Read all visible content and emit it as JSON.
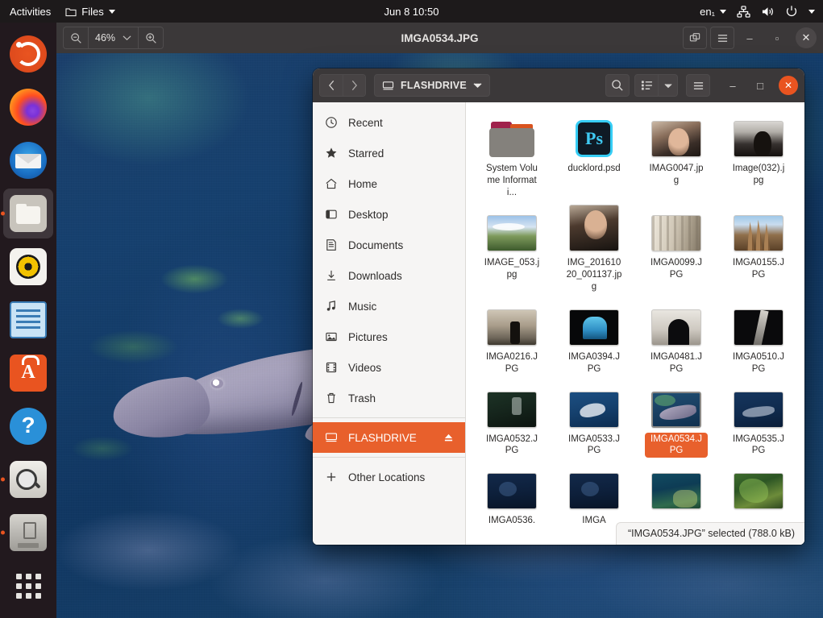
{
  "topbar": {
    "activities": "Activities",
    "app_menu": "Files",
    "clock": "Jun 8  10:50",
    "keyboard": "en₁",
    "icons": [
      "network-icon",
      "volume-icon",
      "power-icon",
      "chevron-down-icon"
    ]
  },
  "dock": {
    "items": [
      {
        "name": "ubuntu-logo",
        "icon": "ubuntu-icon",
        "active": false,
        "running": false
      },
      {
        "name": "firefox",
        "icon": "firefox-icon",
        "active": false,
        "running": false
      },
      {
        "name": "thunderbird",
        "icon": "thunderbird-icon",
        "active": false,
        "running": false
      },
      {
        "name": "files",
        "icon": "files-icon",
        "active": true,
        "running": true
      },
      {
        "name": "rhythmbox",
        "icon": "rhythmbox-icon",
        "active": false,
        "running": false
      },
      {
        "name": "libreoffice-impress",
        "icon": "impress-icon",
        "active": false,
        "running": false
      },
      {
        "name": "ubuntu-software",
        "icon": "software-icon",
        "active": false,
        "running": false
      },
      {
        "name": "help",
        "icon": "help-icon",
        "active": false,
        "running": false
      },
      {
        "name": "image-viewer",
        "icon": "image-viewer-icon",
        "active": false,
        "running": true
      },
      {
        "name": "flashdrive",
        "icon": "usb-drive-icon",
        "active": false,
        "running": true
      },
      {
        "name": "show-applications",
        "icon": "grid-icon",
        "active": false,
        "running": false
      }
    ]
  },
  "image_viewer": {
    "title": "IMGA0534.JPG",
    "zoom_out_icon": "zoom-out-icon",
    "zoom_level": "46%",
    "zoom_dropdown_icon": "chevron-down-icon",
    "zoom_in_icon": "zoom-in-icon",
    "best_fit_icon": "best-fit-icon",
    "menu_icon": "hamburger-menu-icon",
    "minimize": "–",
    "maximize": "▫",
    "close": "✕",
    "image_subject": "shark swimming underwater over a reef"
  },
  "files_window": {
    "header": {
      "back_icon": "chevron-left-icon",
      "forward_icon": "chevron-right-icon",
      "location_icon": "drive-icon",
      "location": "FLASHDRIVE",
      "location_dropdown_icon": "chevron-down-icon",
      "search_icon": "search-icon",
      "view_list_icon": "list-view-icon",
      "view_dropdown_icon": "chevron-down-icon",
      "menu_icon": "hamburger-menu-icon",
      "minimize": "–",
      "maximize": "□",
      "close": "✕"
    },
    "sidebar": [
      {
        "label": "Recent",
        "icon": "clock-icon",
        "selected": false
      },
      {
        "label": "Starred",
        "icon": "star-icon",
        "selected": false
      },
      {
        "label": "Home",
        "icon": "home-icon",
        "selected": false
      },
      {
        "label": "Desktop",
        "icon": "desktop-icon",
        "selected": false
      },
      {
        "label": "Documents",
        "icon": "documents-icon",
        "selected": false
      },
      {
        "label": "Downloads",
        "icon": "download-icon",
        "selected": false
      },
      {
        "label": "Music",
        "icon": "music-icon",
        "selected": false
      },
      {
        "label": "Pictures",
        "icon": "pictures-icon",
        "selected": false
      },
      {
        "label": "Videos",
        "icon": "videos-icon",
        "selected": false
      },
      {
        "label": "Trash",
        "icon": "trash-icon",
        "selected": false
      },
      {
        "label": "FLASHDRIVE",
        "icon": "drive-icon",
        "selected": true,
        "eject_icon": "eject-icon"
      },
      {
        "label": "Other Locations",
        "icon": "plus-icon",
        "selected": false
      }
    ],
    "files": [
      {
        "name": "System Volume Informati...",
        "kind": "folder",
        "thumb": "folder",
        "selected": false
      },
      {
        "name": "ducklord.psd",
        "kind": "photoshop",
        "thumb": "psd",
        "selected": false
      },
      {
        "name": "IMAG0047.jpg",
        "kind": "image",
        "thumb": "px-face1",
        "selected": false
      },
      {
        "name": "Image(032).jpg",
        "kind": "image",
        "thumb": "px-dark1",
        "selected": false
      },
      {
        "name": "IMAGE_053.jpg",
        "kind": "image",
        "thumb": "px-land",
        "selected": false
      },
      {
        "name": "IMG_20161020_001137.jpg",
        "kind": "image",
        "thumb": "px-face2",
        "selected": false
      },
      {
        "name": "IMGA0099.JPG",
        "kind": "image",
        "thumb": "px-build1",
        "selected": false
      },
      {
        "name": "IMGA0155.JPG",
        "kind": "image",
        "thumb": "px-build2",
        "selected": false
      },
      {
        "name": "IMGA0216.JPG",
        "kind": "image",
        "thumb": "px-street",
        "selected": false
      },
      {
        "name": "IMGA0394.JPG",
        "kind": "image",
        "thumb": "px-window",
        "selected": false
      },
      {
        "name": "IMGA0481.JPG",
        "kind": "image",
        "thumb": "px-silh",
        "selected": false
      },
      {
        "name": "IMGA0510.JPG",
        "kind": "image",
        "thumb": "px-dark2",
        "selected": false
      },
      {
        "name": "IMGA0532.JPG",
        "kind": "image",
        "thumb": "px-sea-d",
        "selected": false
      },
      {
        "name": "IMGA0533.JPG",
        "kind": "image",
        "thumb": "px-sea-ray",
        "selected": false
      },
      {
        "name": "IMGA0534.JPG",
        "kind": "image",
        "thumb": "px-sea-shark",
        "selected": true
      },
      {
        "name": "IMGA0535.JPG",
        "kind": "image",
        "thumb": "px-sea-blue",
        "selected": false
      },
      {
        "name": "IMGA0536.",
        "kind": "image",
        "thumb": "px-sea-dark",
        "selected": false
      },
      {
        "name": "IMGA",
        "kind": "image",
        "thumb": "px-sea-dark",
        "selected": false
      },
      {
        "name": "",
        "kind": "image",
        "thumb": "px-sea-reef",
        "selected": false
      },
      {
        "name": "",
        "kind": "image",
        "thumb": "px-sea-weed",
        "selected": false
      }
    ],
    "status": "“IMGA0534.JPG” selected  (788.0 kB)"
  },
  "colors": {
    "accent_orange": "#e8602c",
    "close_orange": "#e95420",
    "header_dark": "#3b3839",
    "sidebar_bg": "#f6f5f4",
    "topbar_bg": "#1d1a1b"
  }
}
